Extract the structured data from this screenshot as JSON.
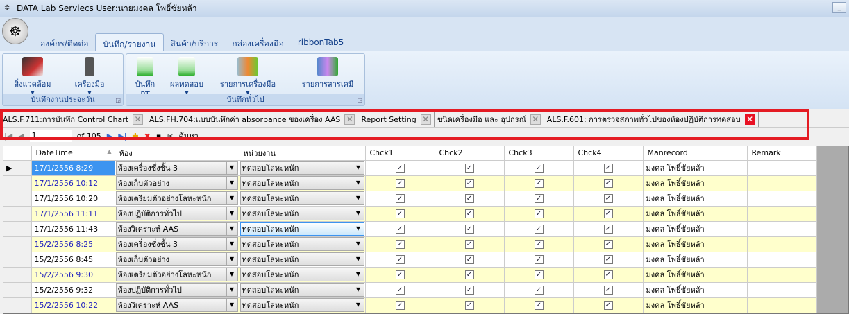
{
  "window": {
    "title": "DATA Lab Serviecs User:นายมงคล โพธิ์ชัยหล้า"
  },
  "ribbon": {
    "tabs": [
      "องค์กร/ติดต่อ",
      "บันทึก/รายงาน",
      "สินค้า/บริการ",
      "กล่องเครื่องมือ",
      "ribbonTab5"
    ],
    "groups": [
      {
        "label": "บันทึกงานประจะวัน",
        "buttons": [
          "สิ่งแวดล้อม",
          "เครื่องมือ"
        ]
      },
      {
        "label": "บันทึกทั่วไป",
        "buttons": [
          "บันทึก PT",
          "ผลทดสอบ",
          "รายการเครื่องมือ",
          "รายการสารเคมี"
        ]
      }
    ]
  },
  "doc_tabs": [
    "ALS.F.711:การบันทึก Control Chart",
    "ALS.FH.704:แบบบันทึกค่า absorbance ของเครื่อง  AAS",
    "Report Setting",
    "ชนิดเครื่องมือ และ อุปกรณ์",
    "ALS.F.601: การตรวจสภาพทั่วไปของห้องปฏิบัติการทดสอบ"
  ],
  "navigator": {
    "position": "1",
    "of": "of 105",
    "search": "ค้นหา"
  },
  "grid": {
    "columns": [
      "DateTime",
      "ห้อง",
      "หน่วยงาน",
      "Chck1",
      "Chck2",
      "Chck3",
      "Chck4",
      "Manrecord",
      "Remark"
    ],
    "rows": [
      [
        "17/1/2556 8:29",
        "ห้องเครื่องชั่งชั้น 3",
        "ทดสอบโลหะหนัก",
        true,
        true,
        true,
        true,
        "มงคล โพธิ์ชัยหล้า",
        ""
      ],
      [
        "17/1/2556 10:12",
        "ห้องเก็บตัวอย่าง",
        "ทดสอบโลหะหนัก",
        true,
        true,
        true,
        true,
        "มงคล โพธิ์ชัยหล้า",
        ""
      ],
      [
        "17/1/2556 10:20",
        "ห้องเตรียมตัวอย่างโลหะหนัก",
        "ทดสอบโลหะหนัก",
        true,
        true,
        true,
        true,
        "มงคล โพธิ์ชัยหล้า",
        ""
      ],
      [
        "17/1/2556 11:11",
        "ห้องปฏิบัติการทั่วไป",
        "ทดสอบโลหะหนัก",
        true,
        true,
        true,
        true,
        "มงคล โพธิ์ชัยหล้า",
        ""
      ],
      [
        "17/1/2556 11:43",
        "ห้องวิเคราะห์ AAS",
        "ทดสอบโลหะหนัก",
        true,
        true,
        true,
        true,
        "มงคล โพธิ์ชัยหล้า",
        ""
      ],
      [
        "15/2/2556 8:25",
        "ห้องเครื่องชั่งชั้น 3",
        "ทดสอบโลหะหนัก",
        true,
        true,
        true,
        true,
        "มงคล โพธิ์ชัยหล้า",
        ""
      ],
      [
        "15/2/2556 8:45",
        "ห้องเก็บตัวอย่าง",
        "ทดสอบโลหะหนัก",
        true,
        true,
        true,
        true,
        "มงคล โพธิ์ชัยหล้า",
        ""
      ],
      [
        "15/2/2556 9:30",
        "ห้องเตรียมตัวอย่างโลหะหนัก",
        "ทดสอบโลหะหนัก",
        true,
        true,
        true,
        true,
        "มงคล โพธิ์ชัยหล้า",
        ""
      ],
      [
        "15/2/2556 9:32",
        "ห้องปฏิบัติการทั่วไป",
        "ทดสอบโลหะหนัก",
        true,
        true,
        true,
        true,
        "มงคล โพธิ์ชัยหล้า",
        ""
      ],
      [
        "15/2/2556 10:22",
        "ห้องวิเคราะห์ AAS",
        "ทดสอบโลหะหนัก",
        true,
        true,
        true,
        true,
        "มงคล โพธิ์ชัยหล้า",
        ""
      ]
    ]
  }
}
